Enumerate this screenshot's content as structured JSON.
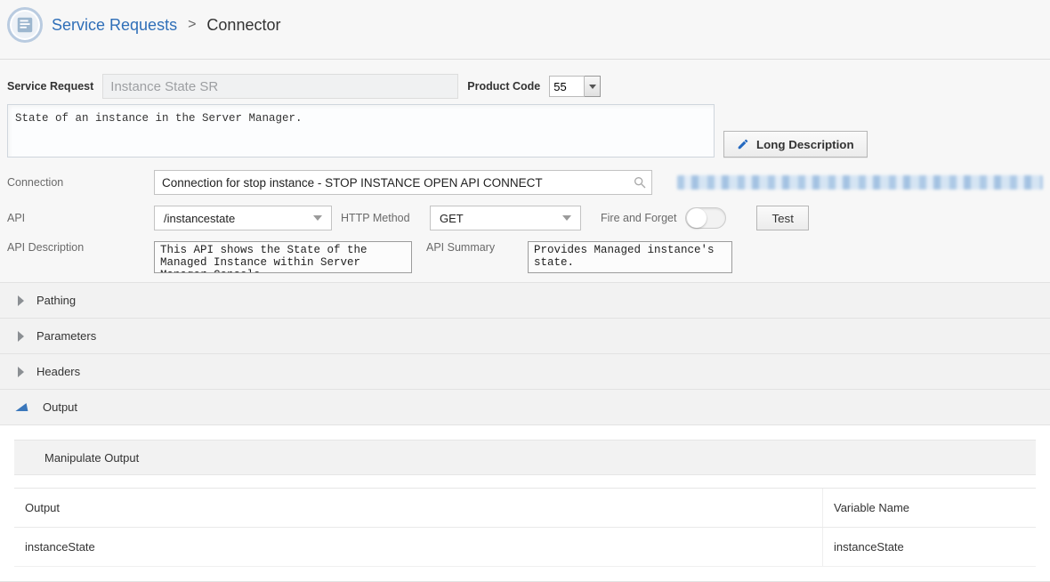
{
  "breadcrumb": {
    "link": "Service Requests",
    "sep": ">",
    "current": "Connector"
  },
  "sr": {
    "label": "Service Request",
    "value": "Instance State SR",
    "product_code_label": "Product Code",
    "product_code_value": "55"
  },
  "description": "State of an instance in the Server Manager.",
  "long_desc_btn": "Long Description",
  "connection": {
    "label": "Connection",
    "value": "Connection for stop instance - STOP INSTANCE OPEN API CONNECT"
  },
  "api": {
    "label": "API",
    "value": "/instancestate",
    "http_method_label": "HTTP Method",
    "http_method_value": "GET",
    "fire_forget_label": "Fire and Forget",
    "test_label": "Test"
  },
  "api_desc": {
    "label": "API Description",
    "value": "This API shows the State of the Managed Instance within Server Manager Console.",
    "summary_label": "API Summary",
    "summary_value": "Provides Managed instance's state."
  },
  "accordions": {
    "pathing": "Pathing",
    "parameters": "Parameters",
    "headers": "Headers",
    "output": "Output",
    "manipulate_output": "Manipulate Output"
  },
  "output_table": {
    "col_output": "Output",
    "col_var": "Variable Name",
    "rows": [
      {
        "output": "instanceState",
        "variable": "instanceState"
      }
    ]
  }
}
